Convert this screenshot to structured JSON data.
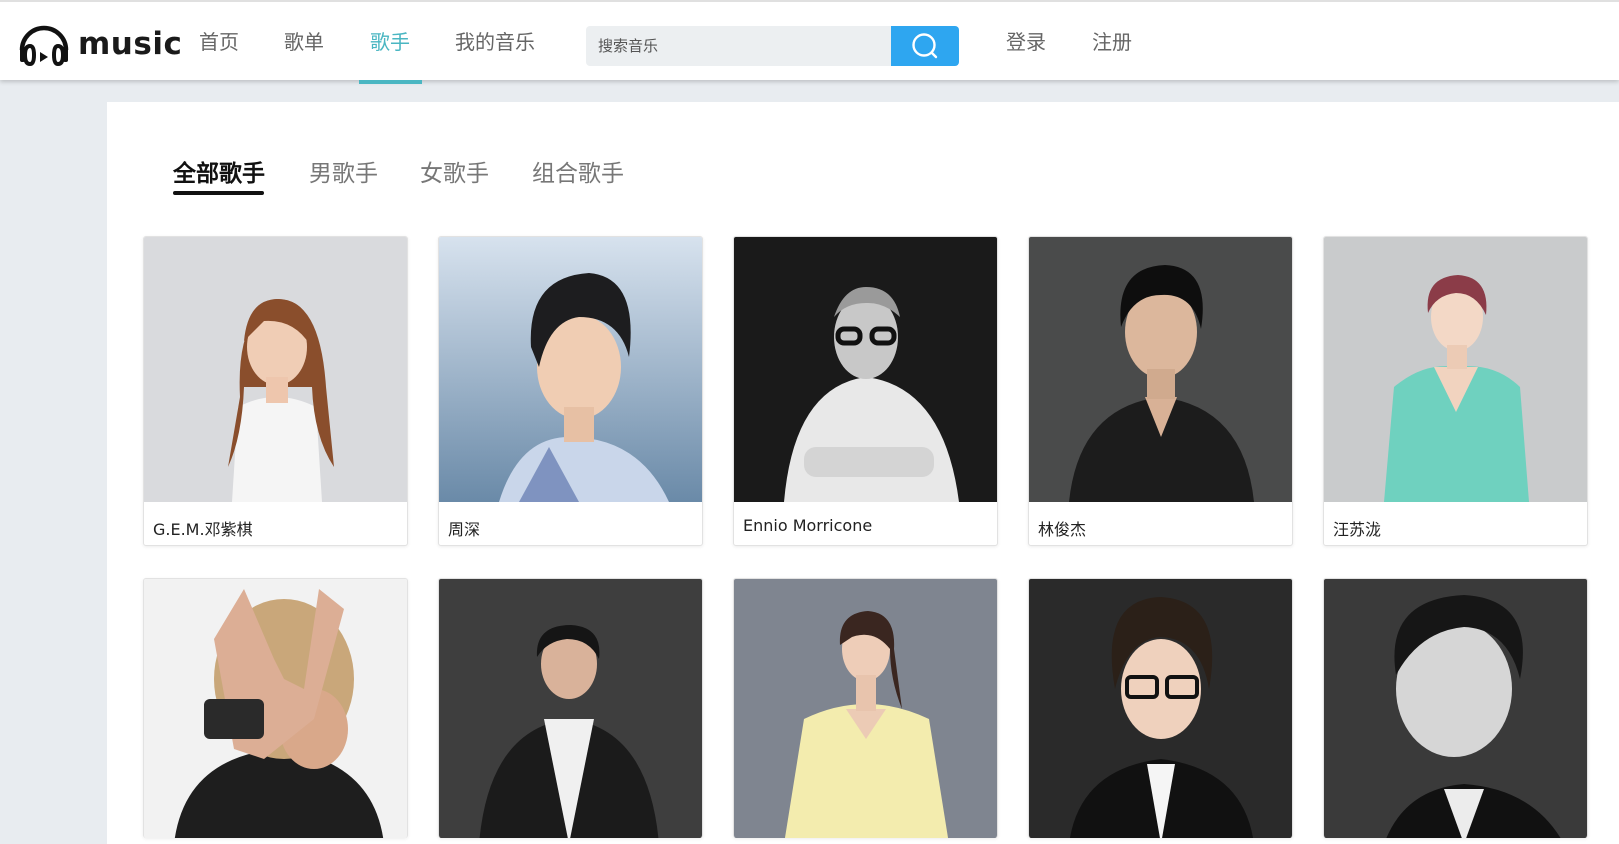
{
  "header": {
    "logo_text": "music",
    "nav": [
      {
        "label": "首页",
        "active": false
      },
      {
        "label": "歌单",
        "active": false
      },
      {
        "label": "歌手",
        "active": true
      },
      {
        "label": "我的音乐",
        "active": false
      }
    ],
    "search": {
      "placeholder": "搜索音乐",
      "value": ""
    },
    "login_label": "登录",
    "register_label": "注册",
    "accent_color": "#4ab6c2",
    "search_button_color": "#2ea6f0"
  },
  "filters": {
    "tabs": [
      {
        "label": "全部歌手",
        "active": true
      },
      {
        "label": "男歌手",
        "active": false
      },
      {
        "label": "女歌手",
        "active": false
      },
      {
        "label": "组合歌手",
        "active": false
      }
    ]
  },
  "singers": [
    {
      "name": "G.E.M.邓紫棋"
    },
    {
      "name": "周深"
    },
    {
      "name": "Ennio Morricone"
    },
    {
      "name": "林俊杰"
    },
    {
      "name": "汪苏泷"
    },
    {
      "name": ""
    },
    {
      "name": ""
    },
    {
      "name": ""
    },
    {
      "name": ""
    },
    {
      "name": ""
    }
  ]
}
